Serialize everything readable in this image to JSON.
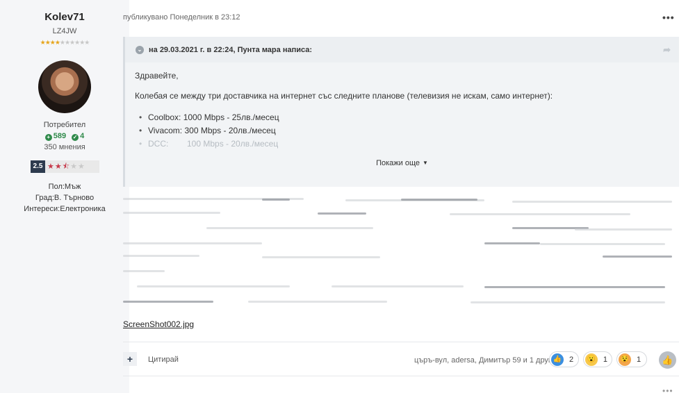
{
  "author": {
    "name": "Kolev71",
    "title": "LZ4JW",
    "rank_stars": 4,
    "rank_stars_total": 10,
    "group": "Потребител",
    "reputation_positive": "589",
    "reputation_badges": "4",
    "posts": "350 мнения",
    "rating": {
      "value": "2.5",
      "stars_filled": 2.5,
      "stars_total": 5
    },
    "fields": [
      "Пол:Мъж",
      "Град:В. Търново",
      "Интереси:Електроника"
    ]
  },
  "post": {
    "meta": "публикувано Понеделник в 23:12",
    "menu_icon": "ellipsis-icon",
    "quote": {
      "header": "на 29.03.2021 г. в 22:24, Пунта мара написа:",
      "greeting": "Здравейте,",
      "intro": "Колебая се между три доставчика на интернет със следните планове (телевизия не искам, само интернет):",
      "items": [
        "Coolbox: 1000 Mbps - 25лв./месец",
        "Vivacom: 300 Mbps - 20лв./месец",
        "DCC:        100 Mbps - 20лв./месец"
      ],
      "show_more": "Покажи още"
    },
    "attachment": "ScreenShot002.jpg",
    "footer": {
      "quote_label": "Цитирай",
      "reactors": "църъ-вул, adersa, Димитър 59 и 1 друг",
      "reactions": [
        {
          "icon": "thumbs-up-icon",
          "count": "2"
        },
        {
          "icon": "wow-face-icon",
          "count": "1"
        },
        {
          "icon": "confused-face-icon",
          "count": "1"
        }
      ]
    }
  }
}
